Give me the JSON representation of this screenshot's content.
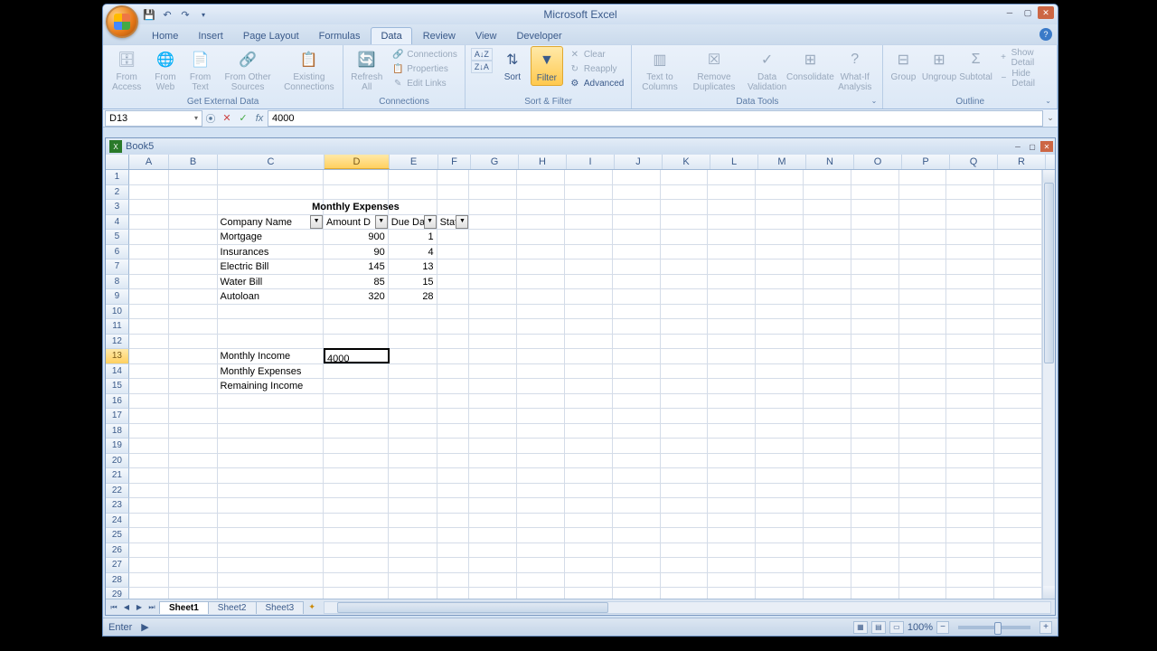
{
  "app_title": "Microsoft Excel",
  "tabs": [
    "Home",
    "Insert",
    "Page Layout",
    "Formulas",
    "Data",
    "Review",
    "View",
    "Developer"
  ],
  "active_tab": "Data",
  "ribbon": {
    "ext_data": {
      "label": "Get External Data",
      "items": [
        "From Access",
        "From Web",
        "From Text",
        "From Other Sources",
        "Existing Connections"
      ]
    },
    "connections": {
      "label": "Connections",
      "refresh": "Refresh All",
      "items": [
        "Connections",
        "Properties",
        "Edit Links"
      ]
    },
    "sort_filter": {
      "label": "Sort & Filter",
      "sort": "Sort",
      "filter": "Filter",
      "clear": "Clear",
      "reapply": "Reapply",
      "advanced": "Advanced"
    },
    "data_tools": {
      "label": "Data Tools",
      "items": [
        "Text to Columns",
        "Remove Duplicates",
        "Data Validation",
        "Consolidate",
        "What-If Analysis"
      ]
    },
    "outline": {
      "label": "Outline",
      "group": "Group",
      "ungroup": "Ungroup",
      "subtotal": "Subtotal",
      "show": "Show Detail",
      "hide": "Hide Detail"
    }
  },
  "name_box": "D13",
  "formula_value": "4000",
  "workbook_name": "Book5",
  "columns": [
    "A",
    "B",
    "C",
    "D",
    "E",
    "F",
    "G",
    "H",
    "I",
    "J",
    "K",
    "L",
    "M",
    "N",
    "O",
    "P",
    "Q",
    "R"
  ],
  "active_col": "D",
  "active_row": 13,
  "cells": {
    "title": "Monthly Expenses",
    "headers": {
      "c": "Company Name",
      "d": "Amount Due",
      "e": "Due Date",
      "f": "Status"
    },
    "rows": [
      {
        "name": "Mortgage",
        "amount": "900",
        "due": "1"
      },
      {
        "name": "Insurances",
        "amount": "90",
        "due": "4"
      },
      {
        "name": "Electric Bill",
        "amount": "145",
        "due": "13"
      },
      {
        "name": "Water Bill",
        "amount": "85",
        "due": "15"
      },
      {
        "name": "Autoloan",
        "amount": "320",
        "due": "28"
      }
    ],
    "summary": [
      {
        "label": "Monthly Income",
        "value": "4000"
      },
      {
        "label": "Monthly Expenses",
        "value": ""
      },
      {
        "label": "Remaining Income",
        "value": ""
      }
    ]
  },
  "sheets": [
    "Sheet1",
    "Sheet2",
    "Sheet3"
  ],
  "active_sheet": "Sheet1",
  "status": "Enter",
  "zoom": "100%"
}
